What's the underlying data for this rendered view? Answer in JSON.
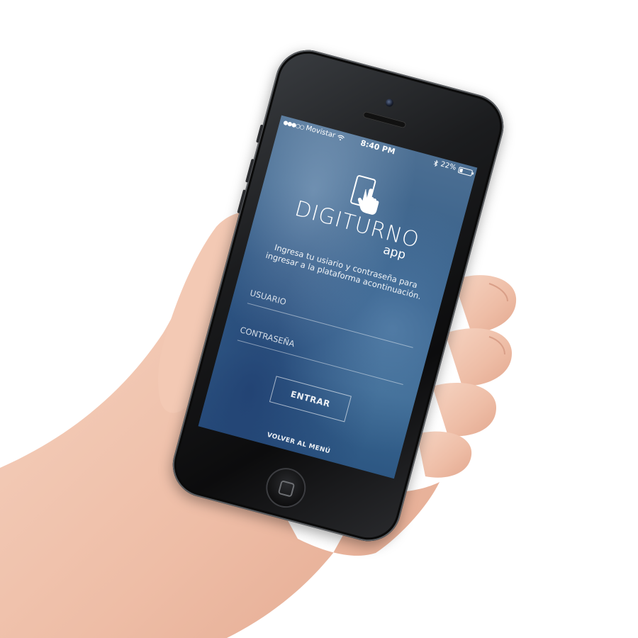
{
  "status_bar": {
    "carrier": "Movistar",
    "time": "8:40 PM",
    "battery": "22%",
    "battery_level": 0.22,
    "icons": [
      "signal-dots-icon",
      "wifi-icon",
      "bluetooth-icon",
      "battery-icon"
    ]
  },
  "app": {
    "brand": "DIGITURNO",
    "brand_sub": "app",
    "logo_icon": "hand-tapping-phone-icon",
    "intro": "Ingresa tu usiario y contraseña para ingresar a la plataforma acontinuación."
  },
  "form": {
    "username_placeholder": "USUARIO",
    "password_placeholder": "CONTRASEÑA",
    "submit_label": "ENTRAR"
  },
  "footer": {
    "back_label": "VOLVER AL MENÚ"
  },
  "colors": {
    "screen_bg": "#3a6892",
    "text": "#ffffff",
    "phone_body": "#0c0c0d"
  }
}
